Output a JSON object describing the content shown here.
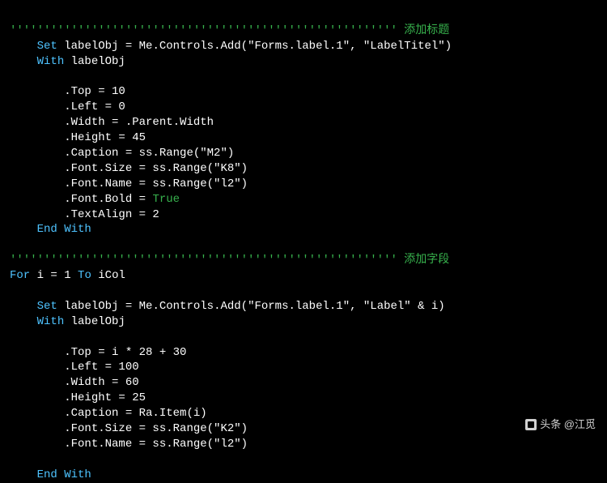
{
  "comments": {
    "ticks": "'''''''''''''''''''''''''''''''''''''''''''''''''''''''''",
    "title": "添加标题",
    "fields": "添加字段"
  },
  "kw": {
    "set": "Set",
    "with": "With",
    "endwith": "End With",
    "for": "For",
    "to": "To",
    "true": "True"
  },
  "b1": {
    "l1": "labelObj = Me.Controls.Add(\"Forms.label.1\", \"LabelTitel\")",
    "l2": "labelObj",
    "p1": ".Top = 10",
    "p2": ".Left = 0",
    "p3": ".Width = .Parent.Width",
    "p4": ".Height = 45",
    "p5": ".Caption = ss.Range(\"M2\")",
    "p6": ".Font.Size = ss.Range(\"K8\")",
    "p7": ".Font.Name = ss.Range(\"l2\")",
    "p8a": ".Font.Bold = ",
    "p9": ".TextAlign = 2"
  },
  "loop": {
    "l1a": "i = 1 ",
    "l1b": " iCol"
  },
  "b2": {
    "l1": "labelObj = Me.Controls.Add(\"Forms.label.1\", \"Label\" & i)",
    "l2": "labelObj",
    "p1": ".Top = i * 28 + 30",
    "p2": ".Left = 100",
    "p3": ".Width = 60",
    "p4": ".Height = 25",
    "p5": ".Caption = Ra.Item(i)",
    "p6": ".Font.Size = ss.Range(\"K2\")",
    "p7": ".Font.Name = ss.Range(\"l2\")"
  },
  "watermark": {
    "text": "头条 @江觅"
  }
}
